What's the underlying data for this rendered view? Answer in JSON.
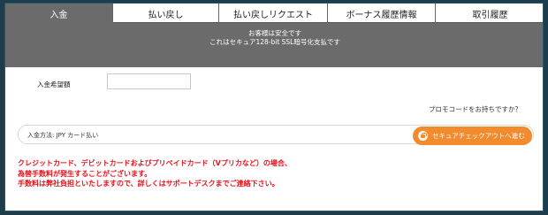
{
  "tabs": [
    {
      "label": "入金",
      "active": true
    },
    {
      "label": "払い戻し",
      "active": false
    },
    {
      "label": "払い戻しリクエスト",
      "active": false
    },
    {
      "label": "ボーナス履歴情報",
      "active": false
    },
    {
      "label": "取引履歴",
      "active": false
    }
  ],
  "banner": {
    "line1": "お客様は安全です",
    "line2": "これはセキュア128-bit SSL暗号化支払です"
  },
  "form": {
    "amount_label": "入金希望額",
    "amount_value": "",
    "promo_link": "プロモコードをお持ちですか？",
    "method_label": "入金方法: JPY カード払い",
    "checkout_label": "セキュアチェックアウトへ進む"
  },
  "notice": {
    "line1": "クレジットカード、デビットカードおよびプリペイドカード（Vプリカなど）の場合、",
    "line2": "為替手数料が発生することがございます。",
    "line3": "手数料は弊社負担といたしますので、詳しくはサポートデスクまでご連絡下さい。"
  },
  "colors": {
    "accent": "#f28a2e",
    "notice": "#e8111a",
    "banner": "#6b6b6b"
  }
}
